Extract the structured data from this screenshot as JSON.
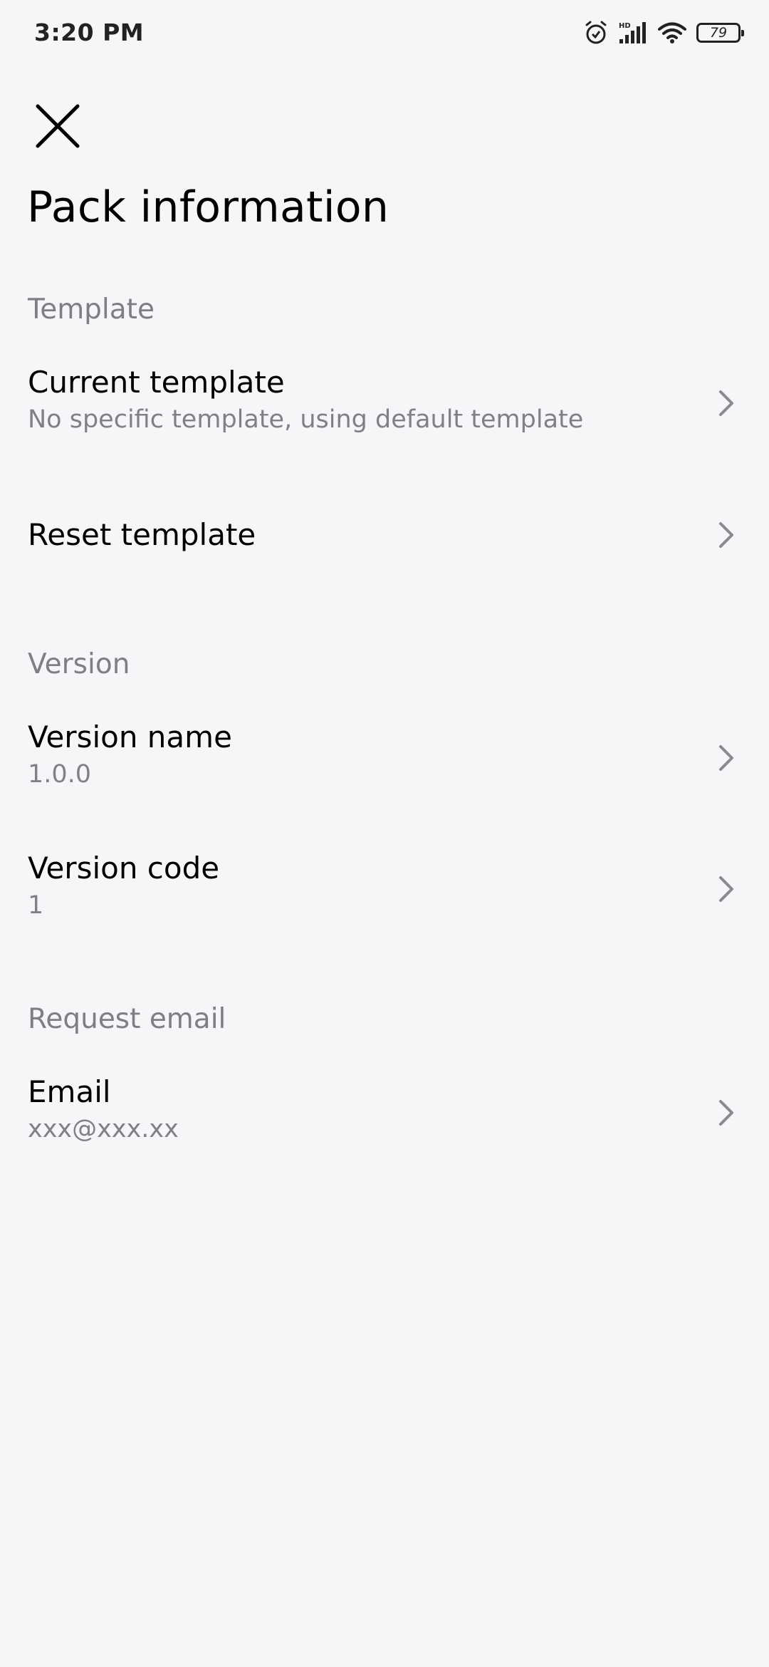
{
  "status_bar": {
    "time": "3:20 PM",
    "battery_level": "79",
    "icons": [
      "alarm-icon",
      "hd-signal-icon",
      "wifi-icon",
      "battery-icon"
    ]
  },
  "header": {
    "close_icon": "close-icon",
    "title": "Pack information"
  },
  "sections": {
    "template": {
      "header": "Template",
      "current_template": {
        "title": "Current template",
        "subtitle": "No specific template, using default template"
      },
      "reset_template": {
        "title": "Reset template"
      }
    },
    "version": {
      "header": "Version",
      "version_name": {
        "title": "Version name",
        "subtitle": "1.0.0"
      },
      "version_code": {
        "title": "Version code",
        "subtitle": "1"
      }
    },
    "request_email": {
      "header": "Request email",
      "email": {
        "title": "Email",
        "subtitle": "xxx@xxx.xx"
      }
    }
  },
  "colors": {
    "background": "#f5f6f8",
    "primary_text": "#000000",
    "secondary_text": "#808087",
    "chevron": "#8a8a8f"
  }
}
